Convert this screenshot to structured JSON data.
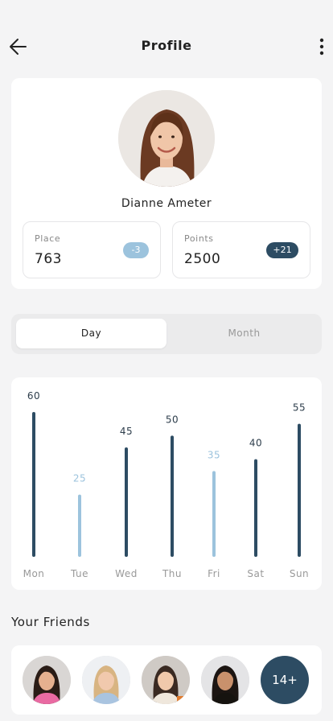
{
  "header": {
    "title": "Profile"
  },
  "profile": {
    "name": "Dianne Ameter",
    "place": {
      "label": "Place",
      "value": "763",
      "change": "-3"
    },
    "points": {
      "label": "Points",
      "value": "2500",
      "change": "+21"
    }
  },
  "tabs": [
    {
      "label": "Day",
      "active": true
    },
    {
      "label": "Month",
      "active": false
    }
  ],
  "chart_data": {
    "type": "bar",
    "categories": [
      "Mon",
      "Tue",
      "Wed",
      "Thu",
      "Fri",
      "Sat",
      "Sun"
    ],
    "values": [
      60,
      25,
      45,
      50,
      35,
      40,
      55
    ],
    "highlighted": [
      false,
      true,
      false,
      false,
      true,
      false,
      false
    ],
    "ylim": [
      0,
      60
    ],
    "title": "",
    "xlabel": "",
    "ylabel": ""
  },
  "friends": {
    "title": "Your Friends",
    "more_count": "14+"
  },
  "colors": {
    "dark_bar": "#2d4c63",
    "light_bar": "#9cc3dd",
    "background": "#f4f4f5",
    "card": "#ffffff"
  }
}
